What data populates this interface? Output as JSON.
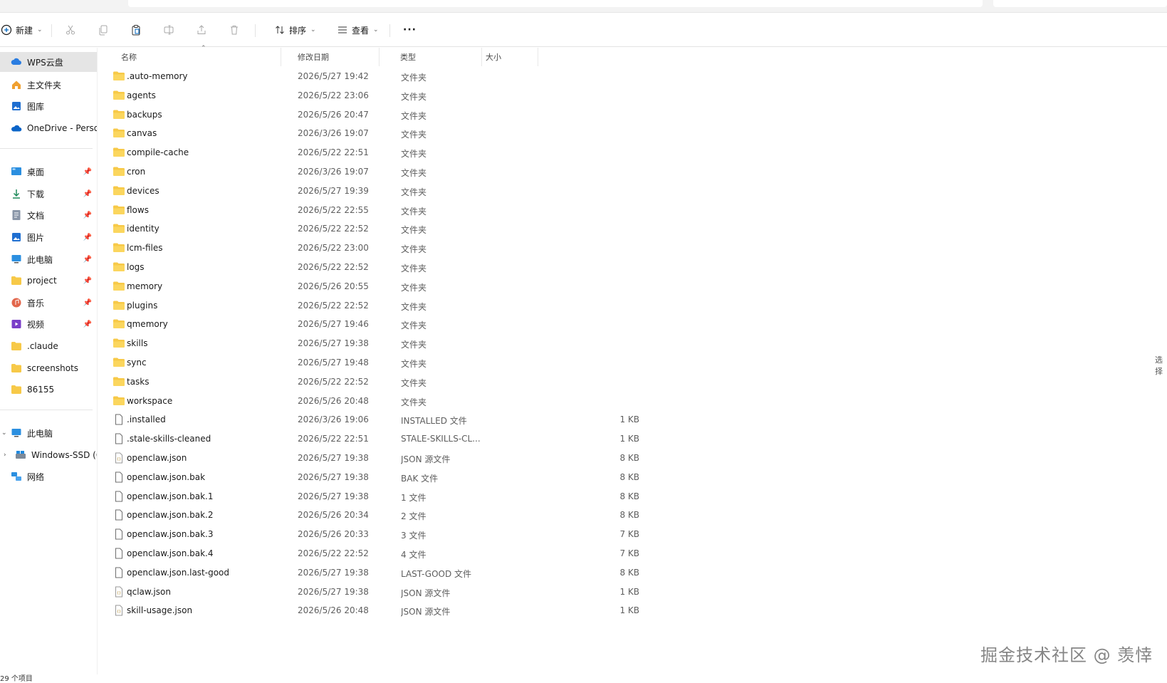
{
  "toolbar": {
    "new_label": "新建",
    "sort_label": "排序",
    "view_label": "查看",
    "more_label": "···"
  },
  "columns": {
    "name": "名称",
    "date": "修改日期",
    "type": "类型",
    "size": "大小"
  },
  "nav": {
    "cloud": [
      "WPS云盘",
      "主文件夹",
      "图库",
      "OneDrive - Perso"
    ],
    "quick": [
      "桌面",
      "下载",
      "文档",
      "图片",
      "此电脑",
      "project",
      "音乐",
      "视频",
      ".claude",
      "screenshots",
      "86155"
    ],
    "devices": [
      "此电脑",
      "Windows-SSD (C",
      "网络"
    ]
  },
  "files": [
    {
      "name": ".auto-memory",
      "date": "2026/5/27 19:42",
      "type": "文件夹",
      "size": "",
      "kind": "folder"
    },
    {
      "name": "agents",
      "date": "2026/5/22 23:06",
      "type": "文件夹",
      "size": "",
      "kind": "folder"
    },
    {
      "name": "backups",
      "date": "2026/5/26 20:47",
      "type": "文件夹",
      "size": "",
      "kind": "folder"
    },
    {
      "name": "canvas",
      "date": "2026/3/26 19:07",
      "type": "文件夹",
      "size": "",
      "kind": "folder"
    },
    {
      "name": "compile-cache",
      "date": "2026/5/22 22:51",
      "type": "文件夹",
      "size": "",
      "kind": "folder"
    },
    {
      "name": "cron",
      "date": "2026/3/26 19:07",
      "type": "文件夹",
      "size": "",
      "kind": "folder"
    },
    {
      "name": "devices",
      "date": "2026/5/27 19:39",
      "type": "文件夹",
      "size": "",
      "kind": "folder"
    },
    {
      "name": "flows",
      "date": "2026/5/22 22:55",
      "type": "文件夹",
      "size": "",
      "kind": "folder"
    },
    {
      "name": "identity",
      "date": "2026/5/22 22:52",
      "type": "文件夹",
      "size": "",
      "kind": "folder"
    },
    {
      "name": "lcm-files",
      "date": "2026/5/22 23:00",
      "type": "文件夹",
      "size": "",
      "kind": "folder"
    },
    {
      "name": "logs",
      "date": "2026/5/22 22:52",
      "type": "文件夹",
      "size": "",
      "kind": "folder"
    },
    {
      "name": "memory",
      "date": "2026/5/26 20:55",
      "type": "文件夹",
      "size": "",
      "kind": "folder"
    },
    {
      "name": "plugins",
      "date": "2026/5/22 22:52",
      "type": "文件夹",
      "size": "",
      "kind": "folder"
    },
    {
      "name": "qmemory",
      "date": "2026/5/27 19:46",
      "type": "文件夹",
      "size": "",
      "kind": "folder"
    },
    {
      "name": "skills",
      "date": "2026/5/27 19:38",
      "type": "文件夹",
      "size": "",
      "kind": "folder"
    },
    {
      "name": "sync",
      "date": "2026/5/27 19:48",
      "type": "文件夹",
      "size": "",
      "kind": "folder"
    },
    {
      "name": "tasks",
      "date": "2026/5/22 22:52",
      "type": "文件夹",
      "size": "",
      "kind": "folder"
    },
    {
      "name": "workspace",
      "date": "2026/5/26 20:48",
      "type": "文件夹",
      "size": "",
      "kind": "folder"
    },
    {
      "name": ".installed",
      "date": "2026/3/26 19:06",
      "type": "INSTALLED 文件",
      "size": "1 KB",
      "kind": "file"
    },
    {
      "name": ".stale-skills-cleaned",
      "date": "2026/5/22 22:51",
      "type": "STALE-SKILLS-CL...",
      "size": "1 KB",
      "kind": "file"
    },
    {
      "name": "openclaw.json",
      "date": "2026/5/27 19:38",
      "type": "JSON 源文件",
      "size": "8 KB",
      "kind": "json"
    },
    {
      "name": "openclaw.json.bak",
      "date": "2026/5/27 19:38",
      "type": "BAK 文件",
      "size": "8 KB",
      "kind": "file"
    },
    {
      "name": "openclaw.json.bak.1",
      "date": "2026/5/27 19:38",
      "type": "1 文件",
      "size": "8 KB",
      "kind": "file"
    },
    {
      "name": "openclaw.json.bak.2",
      "date": "2026/5/26 20:34",
      "type": "2 文件",
      "size": "8 KB",
      "kind": "file"
    },
    {
      "name": "openclaw.json.bak.3",
      "date": "2026/5/26 20:33",
      "type": "3 文件",
      "size": "7 KB",
      "kind": "file"
    },
    {
      "name": "openclaw.json.bak.4",
      "date": "2026/5/22 22:52",
      "type": "4 文件",
      "size": "7 KB",
      "kind": "file"
    },
    {
      "name": "openclaw.json.last-good",
      "date": "2026/5/27 19:38",
      "type": "LAST-GOOD 文件",
      "size": "8 KB",
      "kind": "file"
    },
    {
      "name": "qclaw.json",
      "date": "2026/5/27 19:38",
      "type": "JSON 源文件",
      "size": "1 KB",
      "kind": "json"
    },
    {
      "name": "skill-usage.json",
      "date": "2026/5/26 20:48",
      "type": "JSON 源文件",
      "size": "1 KB",
      "kind": "json"
    }
  ],
  "status": {
    "items": "29 个项目"
  },
  "right_clip": "选择",
  "watermark": "掘金技术社区 @ 羡悻",
  "colors": {
    "folder": "#f7c948",
    "selected_bg": "#e5e5e5",
    "accent": "#0067c0"
  }
}
